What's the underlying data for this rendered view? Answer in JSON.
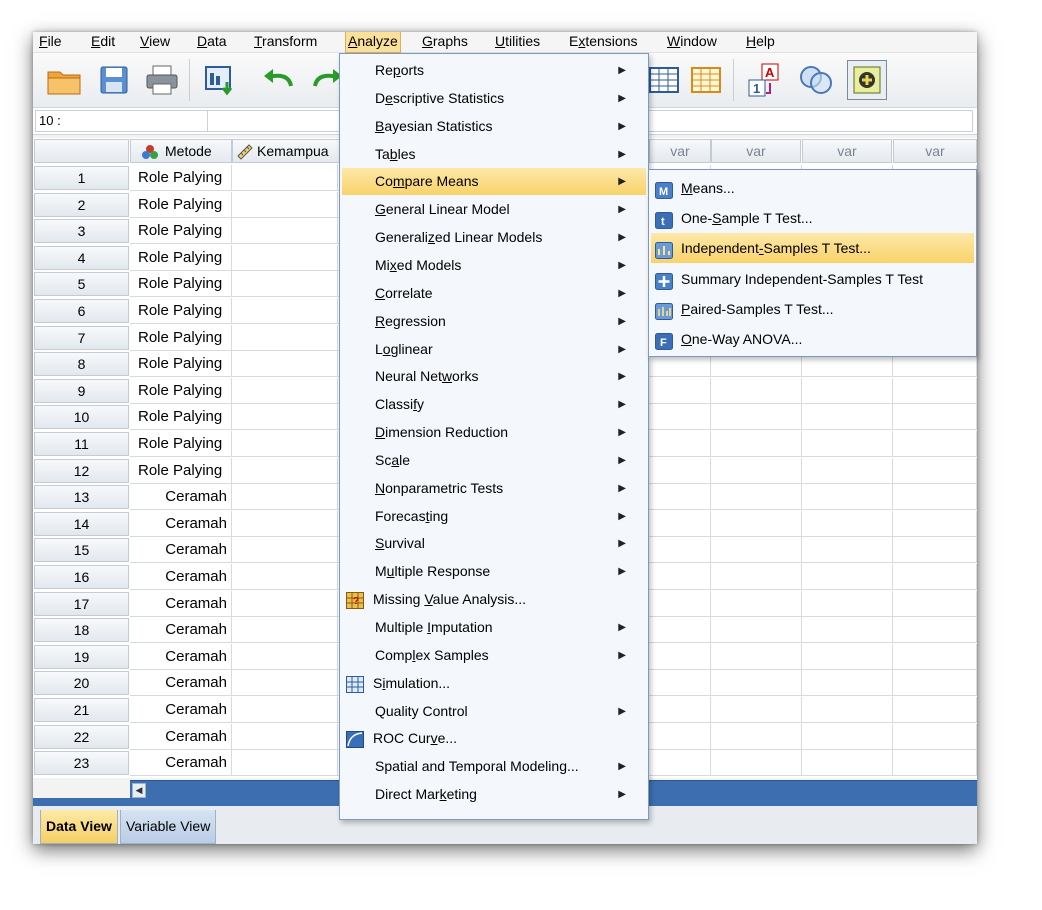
{
  "menubar": [
    {
      "label": "File",
      "u": "F",
      "rest": "ile"
    },
    {
      "label": "Edit",
      "u": "E",
      "rest": "dit"
    },
    {
      "label": "View",
      "u": "V",
      "rest": "iew"
    },
    {
      "label": "Data",
      "u": "D",
      "rest": "ata"
    },
    {
      "label": "Transform",
      "u": "T",
      "rest": "ransform"
    },
    {
      "label": "Analyze",
      "u": "A",
      "rest": "nalyze"
    },
    {
      "label": "Graphs",
      "u": "G",
      "rest": "raphs"
    },
    {
      "label": "Utilities",
      "u": "U",
      "rest": "tilities"
    },
    {
      "label": "Extensions",
      "pre": "E",
      "u": "x",
      "rest": "tensions"
    },
    {
      "label": "Window",
      "u": "W",
      "rest": "indow"
    },
    {
      "label": "Help",
      "u": "H",
      "rest": "elp"
    }
  ],
  "cell_ref": "10 :",
  "columns": {
    "metode": "Metode",
    "kemampuan": "Kemampua",
    "var": "var"
  },
  "rows": [
    {
      "n": "1",
      "metode": "Role Palying"
    },
    {
      "n": "2",
      "metode": "Role Palying"
    },
    {
      "n": "3",
      "metode": "Role Palying"
    },
    {
      "n": "4",
      "metode": "Role Palying"
    },
    {
      "n": "5",
      "metode": "Role Palying"
    },
    {
      "n": "6",
      "metode": "Role Palying"
    },
    {
      "n": "7",
      "metode": "Role Palying"
    },
    {
      "n": "8",
      "metode": "Role Palying"
    },
    {
      "n": "9",
      "metode": "Role Palying"
    },
    {
      "n": "10",
      "metode": "Role Palying"
    },
    {
      "n": "11",
      "metode": "Role Palying"
    },
    {
      "n": "12",
      "metode": "Role Palying"
    },
    {
      "n": "13",
      "metode": "Ceramah"
    },
    {
      "n": "14",
      "metode": "Ceramah"
    },
    {
      "n": "15",
      "metode": "Ceramah"
    },
    {
      "n": "16",
      "metode": "Ceramah"
    },
    {
      "n": "17",
      "metode": "Ceramah"
    },
    {
      "n": "18",
      "metode": "Ceramah"
    },
    {
      "n": "19",
      "metode": "Ceramah"
    },
    {
      "n": "20",
      "metode": "Ceramah"
    },
    {
      "n": "21",
      "metode": "Ceramah"
    },
    {
      "n": "22",
      "metode": "Ceramah"
    },
    {
      "n": "23",
      "metode": "Ceramah"
    }
  ],
  "analyze_menu": [
    {
      "pre": "Re",
      "u": "p",
      "rest": "orts",
      "sub": true
    },
    {
      "pre": "D",
      "u": "e",
      "rest": "scriptive Statistics",
      "sub": true
    },
    {
      "pre": "",
      "u": "B",
      "rest": "ayesian Statistics",
      "sub": true
    },
    {
      "pre": "Ta",
      "u": "b",
      "rest": "les",
      "sub": true
    },
    {
      "pre": "Co",
      "u": "m",
      "rest": "pare Means",
      "sub": true,
      "hl": true
    },
    {
      "pre": "",
      "u": "G",
      "rest": "eneral Linear Model",
      "sub": true
    },
    {
      "pre": "Generali",
      "u": "z",
      "rest": "ed Linear Models",
      "sub": true
    },
    {
      "pre": "Mi",
      "u": "x",
      "rest": "ed Models",
      "sub": true
    },
    {
      "pre": "",
      "u": "C",
      "rest": "orrelate",
      "sub": true
    },
    {
      "pre": "",
      "u": "R",
      "rest": "egression",
      "sub": true
    },
    {
      "pre": "L",
      "u": "o",
      "rest": "glinear",
      "sub": true
    },
    {
      "pre": "Neural Net",
      "u": "w",
      "rest": "orks",
      "sub": true
    },
    {
      "pre": "Classi",
      "u": "f",
      "rest": "y",
      "sub": true
    },
    {
      "pre": "",
      "u": "D",
      "rest": "imension Reduction",
      "sub": true
    },
    {
      "pre": "Sc",
      "u": "a",
      "rest": "le",
      "sub": true
    },
    {
      "pre": "",
      "u": "N",
      "rest": "onparametric Tests",
      "sub": true
    },
    {
      "pre": "Forecas",
      "u": "t",
      "rest": "ing",
      "sub": true
    },
    {
      "pre": "",
      "u": "S",
      "rest": "urvival",
      "sub": true
    },
    {
      "pre": "M",
      "u": "u",
      "rest": "ltiple Response",
      "sub": true
    },
    {
      "pre": "Missing ",
      "u": "V",
      "rest": "alue Analysis...",
      "sub": false,
      "icon": "missing-value-icon"
    },
    {
      "pre": "Multiple ",
      "u": "I",
      "rest": "mputation",
      "sub": true
    },
    {
      "pre": "Comp",
      "u": "l",
      "rest": "ex Samples",
      "sub": true
    },
    {
      "pre": "S",
      "u": "i",
      "rest": "mulation...",
      "sub": false,
      "icon": "simulation-icon"
    },
    {
      "pre": "Quality Control",
      "u": "",
      "rest": "",
      "sub": true
    },
    {
      "pre": "ROC Cur",
      "u": "v",
      "rest": "e...",
      "sub": false,
      "icon": "roc-curve-icon"
    },
    {
      "pre": "Spatial and Temporal Modeling...",
      "u": "",
      "rest": "",
      "sub": true
    },
    {
      "pre": "Direct Mar",
      "u": "k",
      "rest": "eting",
      "sub": true
    }
  ],
  "compare_means_menu": [
    {
      "pre": "",
      "u": "M",
      "rest": "eans...",
      "icon": "means-icon"
    },
    {
      "pre": "One-",
      "u": "S",
      "rest": "ample T Test...",
      "icon": "one-sample-t-icon"
    },
    {
      "pre": "Independent",
      "u": "-",
      "rest": "Samples T Test...",
      "icon": "independent-t-icon",
      "hl": true
    },
    {
      "pre": "Summary Independent-Samples T Test",
      "u": "",
      "rest": "",
      "icon": "summary-t-icon"
    },
    {
      "pre": "",
      "u": "P",
      "rest": "aired-Samples T Test...",
      "icon": "paired-t-icon"
    },
    {
      "pre": "",
      "u": "O",
      "rest": "ne-Way ANOVA...",
      "icon": "anova-icon"
    }
  ],
  "tabs": {
    "data_view": "Data View",
    "variable_view": "Variable View"
  },
  "colors": {
    "highlight": "#f9d36a",
    "accent": "#3d6fb0"
  }
}
